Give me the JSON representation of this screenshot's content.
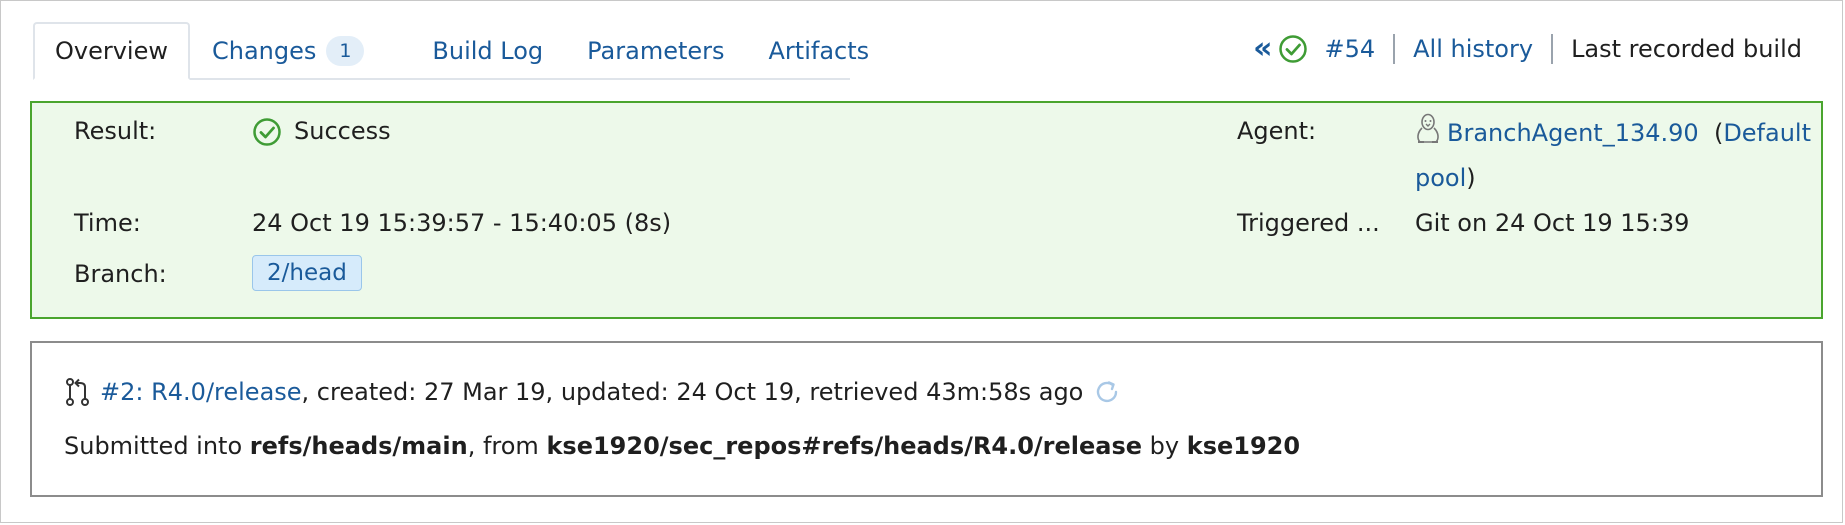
{
  "tabs": [
    {
      "label": "Overview",
      "active": true
    },
    {
      "label": "Changes",
      "badge": "1"
    },
    {
      "label": "Build Log"
    },
    {
      "label": "Parameters"
    },
    {
      "label": "Artifacts"
    }
  ],
  "header_nav": {
    "prev_icon": "double-chevron-left-icon",
    "status_icon": "check-circle-icon",
    "build_number": "#54",
    "all_history": "All history",
    "last_recorded": "Last recorded build"
  },
  "result": {
    "result_label": "Result:",
    "result_icon": "check-circle-icon",
    "result_value": "Success",
    "time_label": "Time:",
    "time_value": "24 Oct 19 15:39:57 - 15:40:05 (8s)",
    "branch_label": "Branch:",
    "branch_value": "2/head",
    "agent_label": "Agent:",
    "agent_icon": "linux-penguin-icon",
    "agent_name": "BranchAgent_134.90",
    "agent_pool_open": "(",
    "agent_pool": "Default pool",
    "agent_pool_close": ")",
    "triggered_label": "Triggered ...",
    "triggered_value": "Git on 24 Oct 19 15:39"
  },
  "pull_request": {
    "pr_icon": "pull-request-icon",
    "pr_link": "#2: R4.0/release",
    "pr_meta": ", created: 27 Mar 19, updated: 24 Oct 19, retrieved 43m:58s ago",
    "refresh_icon": "refresh-icon",
    "submitted_prefix": "Submitted into ",
    "target_ref": "refs/heads/main",
    "from_text": ", from ",
    "source_ref": "kse1920/sec_repos#refs/heads/R4.0/release",
    "by_text": " by ",
    "author": "kse1920"
  },
  "colors": {
    "link": "#1a5a9a",
    "success_green": "#4aa52e",
    "success_bg": "#edf9ea",
    "badge_bg": "#e3eef8",
    "chip_bg": "#d6ebfb"
  }
}
